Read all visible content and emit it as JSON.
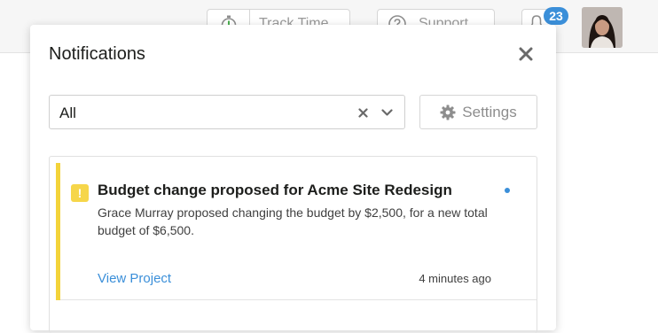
{
  "topbar": {
    "track_time_label": "Track Time",
    "support_label": "Support",
    "notifications_count": "23"
  },
  "panel": {
    "title": "Notifications",
    "filter": {
      "value": "All"
    },
    "settings_label": "Settings"
  },
  "notifications": [
    {
      "title": "Budget change proposed for Acme Site Redesign",
      "body": "Grace Murray proposed changing the budget by $2,500, for a new total budget of $6,500.",
      "link_label": "View Project",
      "time": "4 minutes ago",
      "severity_icon": "warning-icon",
      "accent_color": "#f3d33a",
      "unread": true
    }
  ],
  "colors": {
    "accent_blue": "#3b8fd9",
    "warning_yellow": "#f3d33a"
  }
}
